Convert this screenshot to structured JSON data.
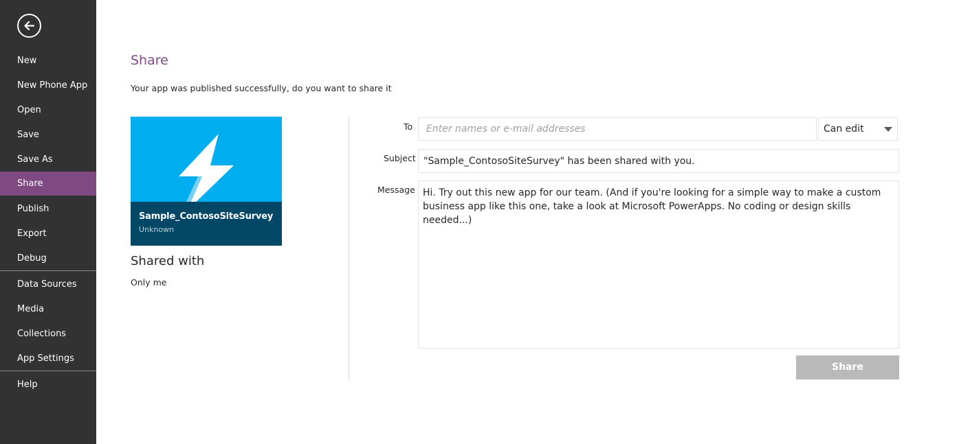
{
  "sidebar": {
    "back_icon": "arrow-left-circle-icon",
    "items": [
      {
        "label": "New"
      },
      {
        "label": "New Phone App"
      },
      {
        "label": "Open"
      },
      {
        "label": "Save"
      },
      {
        "label": "Save As"
      },
      {
        "label": "Share",
        "active": true
      },
      {
        "label": "Publish"
      },
      {
        "label": "Export"
      },
      {
        "label": "Debug"
      },
      {
        "label": "Data Sources"
      },
      {
        "label": "Media"
      },
      {
        "label": "Collections"
      },
      {
        "label": "App Settings"
      },
      {
        "label": "Help"
      }
    ],
    "active_color": "#7f4a82",
    "background_color": "#323232"
  },
  "page": {
    "title": "Share",
    "subtitle": "Your app was published successfully, do you want to share it"
  },
  "app_tile": {
    "name": "Sample_ContosoSiteSurvey",
    "owner": "Unknown",
    "icon": "lightning-bolt-icon",
    "tile_color": "#00adef",
    "band_color": "#024766"
  },
  "shared_with": {
    "heading": "Shared with",
    "value": "Only me"
  },
  "form": {
    "to_label": "To",
    "to_placeholder": "Enter names or e-mail addresses",
    "to_value": "",
    "permission": "Can edit",
    "subject_label": "Subject",
    "subject_value": "\"Sample_ContosoSiteSurvey\" has been shared with you.",
    "message_label": "Message",
    "message_value": "Hi. Try out this new app for our team. (And if you're looking for a simple way to make a custom business app like this one, take a look at Microsoft PowerApps. No coding or design skills needed...)",
    "share_label": "Share"
  }
}
